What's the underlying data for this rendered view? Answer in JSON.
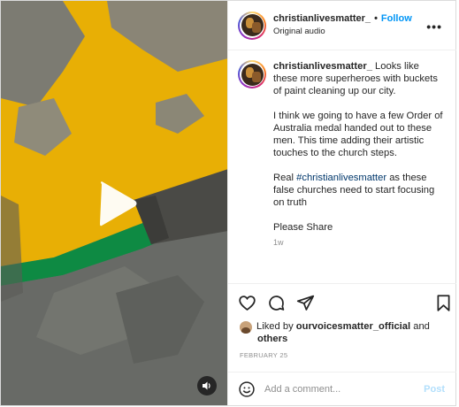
{
  "post": {
    "username": "christianlivesmatter_",
    "separator": "•",
    "follow_label": "Follow",
    "audio_label": "Original audio",
    "more_label": "•••"
  },
  "caption": {
    "username": "christianlivesmatter_",
    "paragraph1_text": " Looks like these more superheroes with buckets of paint cleaning up our city.",
    "paragraph2": "I think we going to have a few Order of Australia medal handed out to these men. This time adding their artistic touches to the church steps.",
    "paragraph3_before": "Real ",
    "hashtag": "#christianlivesmatter",
    "paragraph3_after": " as these false churches need to start focusing on truth",
    "paragraph4": "Please Share",
    "time_ago": "1w"
  },
  "actions": {
    "like_icon": "heart-icon",
    "comment_icon": "comment-icon",
    "share_icon": "send-icon",
    "save_icon": "bookmark-icon"
  },
  "likes": {
    "prefix": "Liked by ",
    "user": "ourvoicesmatter_official",
    "middle": " and",
    "others": "others"
  },
  "date": "FEBRUARY 25",
  "comment": {
    "placeholder": "Add a comment...",
    "post_label": "Post",
    "emoji_icon": "smiley-icon"
  },
  "media": {
    "type": "video",
    "play_icon": "play-icon",
    "audio_icon": "speaker-icon"
  },
  "colors": {
    "accent": "#0095f6",
    "hashtag": "#00376b",
    "paint_yellow": "#eab100",
    "paint_green": "#0e8a43",
    "concrete": "#6d6f6b"
  }
}
